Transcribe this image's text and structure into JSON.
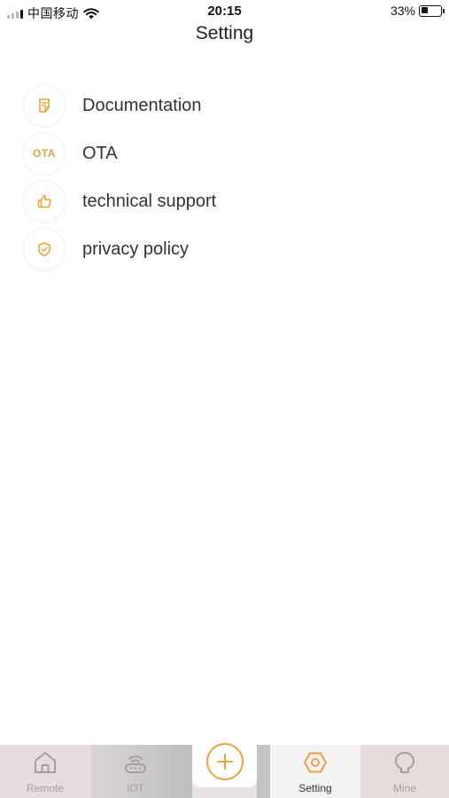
{
  "status_bar": {
    "carrier": "中国移动",
    "time": "20:15",
    "battery_percent_label": "33%",
    "battery_level": 0.33,
    "signal_bars": 4,
    "signal_strength": 1,
    "wifi_icon": "wifi-icon"
  },
  "header": {
    "title": "Setting"
  },
  "menu": {
    "items": [
      {
        "label": "Documentation",
        "icon": "document-icon"
      },
      {
        "label": "OTA",
        "icon_text": "OTA",
        "icon": "ota-icon"
      },
      {
        "label": "technical support",
        "icon": "thumbs-up-icon"
      },
      {
        "label": "privacy policy",
        "icon": "shield-check-icon"
      }
    ]
  },
  "tab_bar": {
    "tabs": [
      {
        "label": "Remote",
        "icon": "home-icon",
        "active": false
      },
      {
        "label": "IOT",
        "icon": "router-icon",
        "active": false
      },
      {
        "label": "",
        "icon": "add-circle-icon",
        "active": false
      },
      {
        "label": "Setting",
        "icon": "hexagon-nut-icon",
        "active": true
      },
      {
        "label": "Mine",
        "icon": "user-head-icon",
        "active": false
      }
    ]
  },
  "colors": {
    "accent": "#E9A442",
    "text": "#333333",
    "tab_inactive": "#A99D9D",
    "tab_bar_bg": "#E8E2E2",
    "background": "#FFFFFF"
  }
}
